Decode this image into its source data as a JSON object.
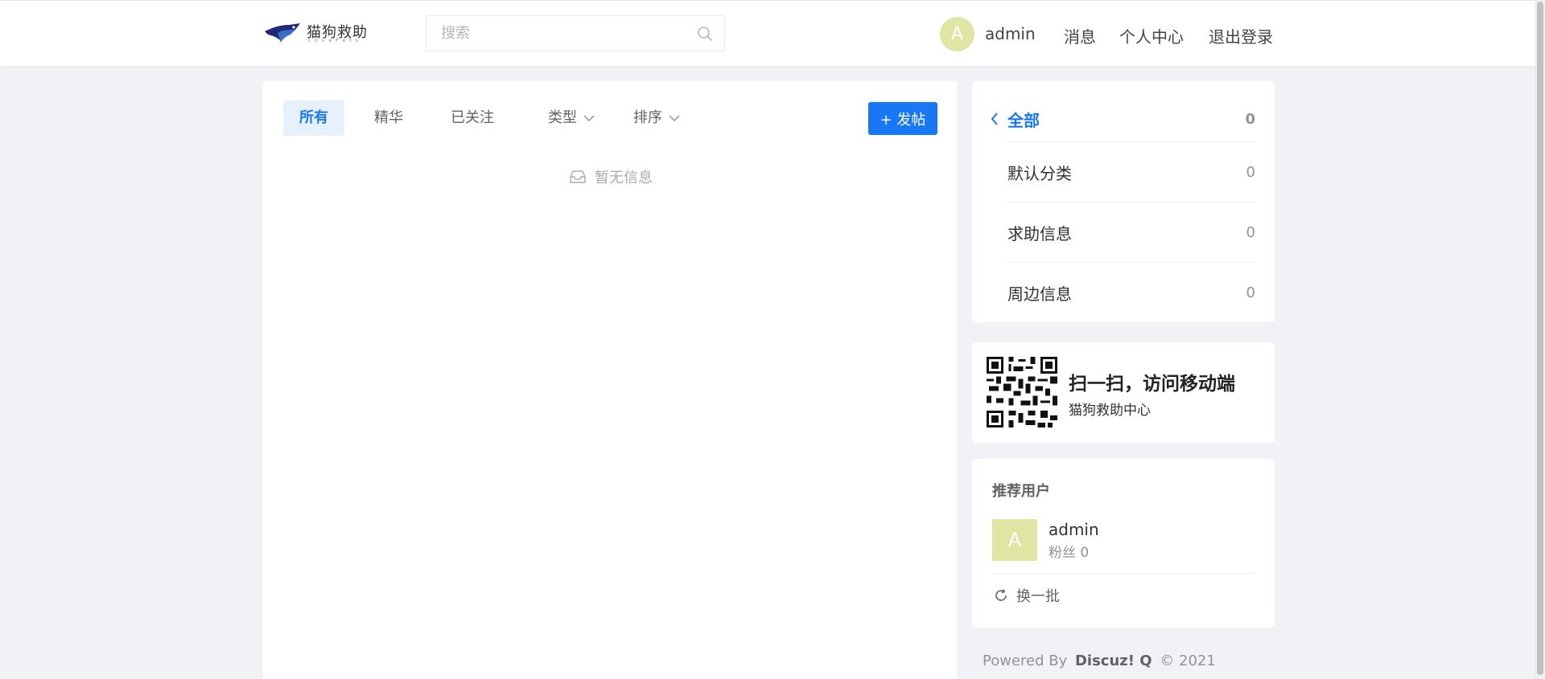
{
  "header": {
    "logo_text": "猫狗救助",
    "logo_sub": "LovePets",
    "search_placeholder": "搜索",
    "avatar_letter": "A",
    "username": "admin",
    "nav": [
      "消息",
      "个人中心",
      "退出登录"
    ]
  },
  "main": {
    "tabs": [
      "所有",
      "精华",
      "已关注"
    ],
    "dropdowns": [
      "类型",
      "排序"
    ],
    "post_button": "+ 发帖",
    "empty_text": "暂无信息"
  },
  "categories": {
    "all_label": "全部",
    "all_count": "0",
    "items": [
      {
        "label": "默认分类",
        "count": "0"
      },
      {
        "label": "求助信息",
        "count": "0"
      },
      {
        "label": "周边信息",
        "count": "0"
      }
    ]
  },
  "qr": {
    "title": "扫一扫，访问移动端",
    "subtitle": "猫狗救助中心"
  },
  "recommend": {
    "title": "推荐用户",
    "user": {
      "avatar_letter": "A",
      "name": "admin",
      "fans": "粉丝 0"
    },
    "refresh": "换一批"
  },
  "footer": {
    "powered": "Powered By",
    "brand": "Discuz! Q",
    "copyright": "© 2021"
  },
  "colors": {
    "accent": "#1878f3",
    "avatar_bg": "#dfe5a3",
    "page_bg": "#f0f2f5"
  }
}
